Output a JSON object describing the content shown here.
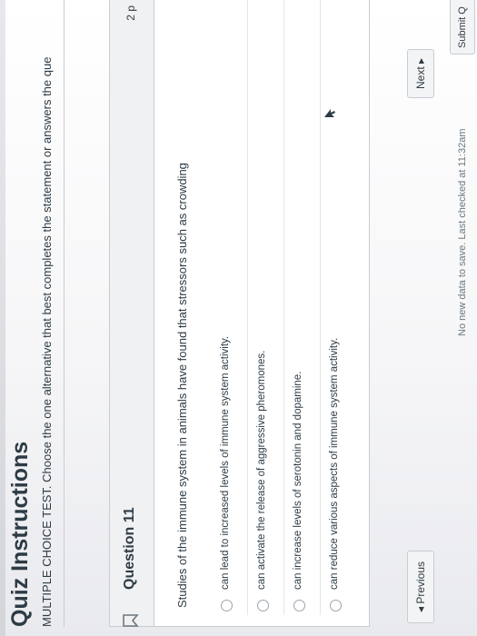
{
  "header": {
    "title": "Quiz Instructions",
    "instructions": "MULTIPLE CHOICE TEST. Choose the one alternative that best completes the statement or answers the que"
  },
  "question": {
    "title": "Question 11",
    "points": "2 p",
    "text": "Studies of the immune system in animals have found that stressors such as crowding",
    "answers": [
      "can lead to increased levels of immune system activity.",
      "can activate the release of aggressive pheromones.",
      "can increase levels of serotonin and dopamine.",
      "can reduce various aspects of immune system activity."
    ]
  },
  "footer": {
    "previous_label": "◂ Previous",
    "next_label": "Next ▸",
    "save_status": "No new data to save. Last checked at 11:32am",
    "submit_label": "Submit Q"
  },
  "colors": {
    "text": "#2d3b45",
    "border": "#c7cdd1",
    "header_bg": "#f0f1f3"
  },
  "icons": [
    "flag-icon",
    "cursor-icon"
  ]
}
